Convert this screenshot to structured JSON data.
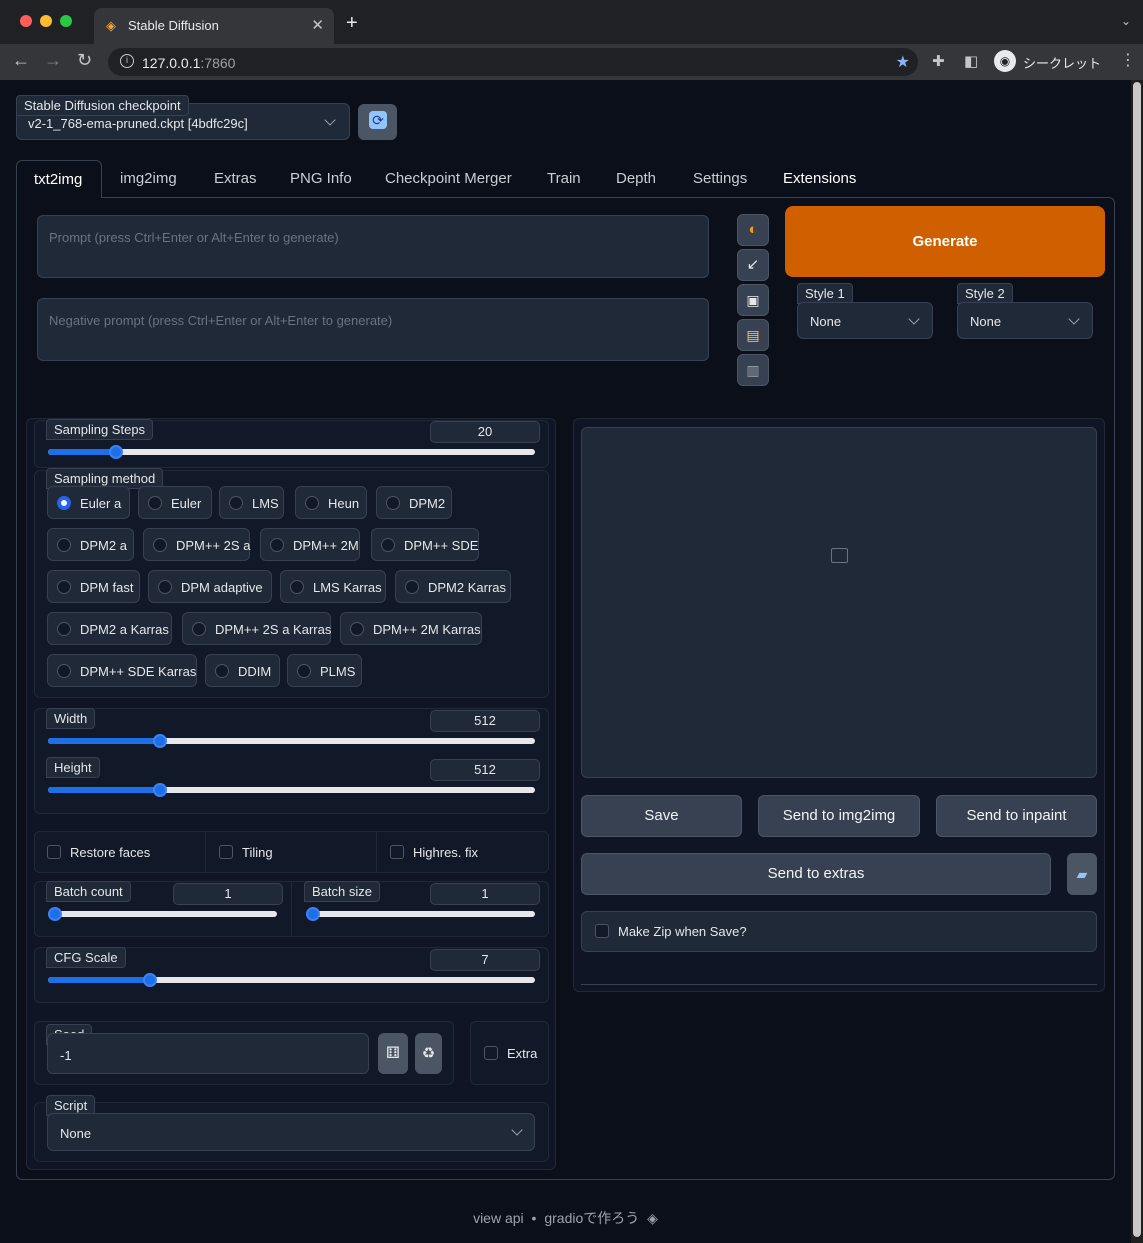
{
  "browser": {
    "tab_title": "Stable Diffusion",
    "url_host": "127.0.0.1",
    "url_port": ":7860",
    "incognito_label": "シークレット"
  },
  "checkpoint": {
    "label": "Stable Diffusion checkpoint",
    "value": "v2-1_768-ema-pruned.ckpt [4bdfc29c]"
  },
  "tabs": [
    "txt2img",
    "img2img",
    "Extras",
    "PNG Info",
    "Checkpoint Merger",
    "Train",
    "Depth",
    "Settings",
    "Extensions"
  ],
  "prompt": {
    "placeholder": "Prompt (press Ctrl+Enter or Alt+Enter to generate)",
    "negative_placeholder": "Negative prompt (press Ctrl+Enter or Alt+Enter to generate)"
  },
  "generate_label": "Generate",
  "styles": [
    {
      "label": "Style 1",
      "value": "None"
    },
    {
      "label": "Style 2",
      "value": "None"
    }
  ],
  "sampling_steps": {
    "label": "Sampling Steps",
    "value": "20",
    "fraction": 0.14
  },
  "sampling_method": {
    "label": "Sampling method",
    "options": [
      "Euler a",
      "Euler",
      "LMS",
      "Heun",
      "DPM2",
      "DPM2 a",
      "DPM++ 2S a",
      "DPM++ 2M",
      "DPM++ SDE",
      "DPM fast",
      "DPM adaptive",
      "LMS Karras",
      "DPM2 Karras",
      "DPM2 a Karras",
      "DPM++ 2S a Karras",
      "DPM++ 2M Karras",
      "DPM++ SDE Karras",
      "DDIM",
      "PLMS"
    ],
    "selected": "Euler a"
  },
  "width": {
    "label": "Width",
    "value": "512",
    "fraction": 0.23
  },
  "height": {
    "label": "Height",
    "value": "512",
    "fraction": 0.23
  },
  "checkboxes": {
    "restore_faces": "Restore faces",
    "tiling": "Tiling",
    "highres_fix": "Highres. fix"
  },
  "batch_count": {
    "label": "Batch count",
    "value": "1",
    "fraction": 0.0
  },
  "batch_size": {
    "label": "Batch size",
    "value": "1",
    "fraction": 0.0
  },
  "cfg_scale": {
    "label": "CFG Scale",
    "value": "7",
    "fraction": 0.21
  },
  "seed": {
    "label": "Seed",
    "value": "-1",
    "extra_label": "Extra"
  },
  "script": {
    "label": "Script",
    "value": "None"
  },
  "output": {
    "save": "Save",
    "send_img2img": "Send to img2img",
    "send_inpaint": "Send to inpaint",
    "send_extras": "Send to extras",
    "make_zip": "Make Zip when Save?"
  },
  "footer": {
    "api": "view api",
    "sep": "•",
    "gradio": "gradioで作ろう"
  }
}
